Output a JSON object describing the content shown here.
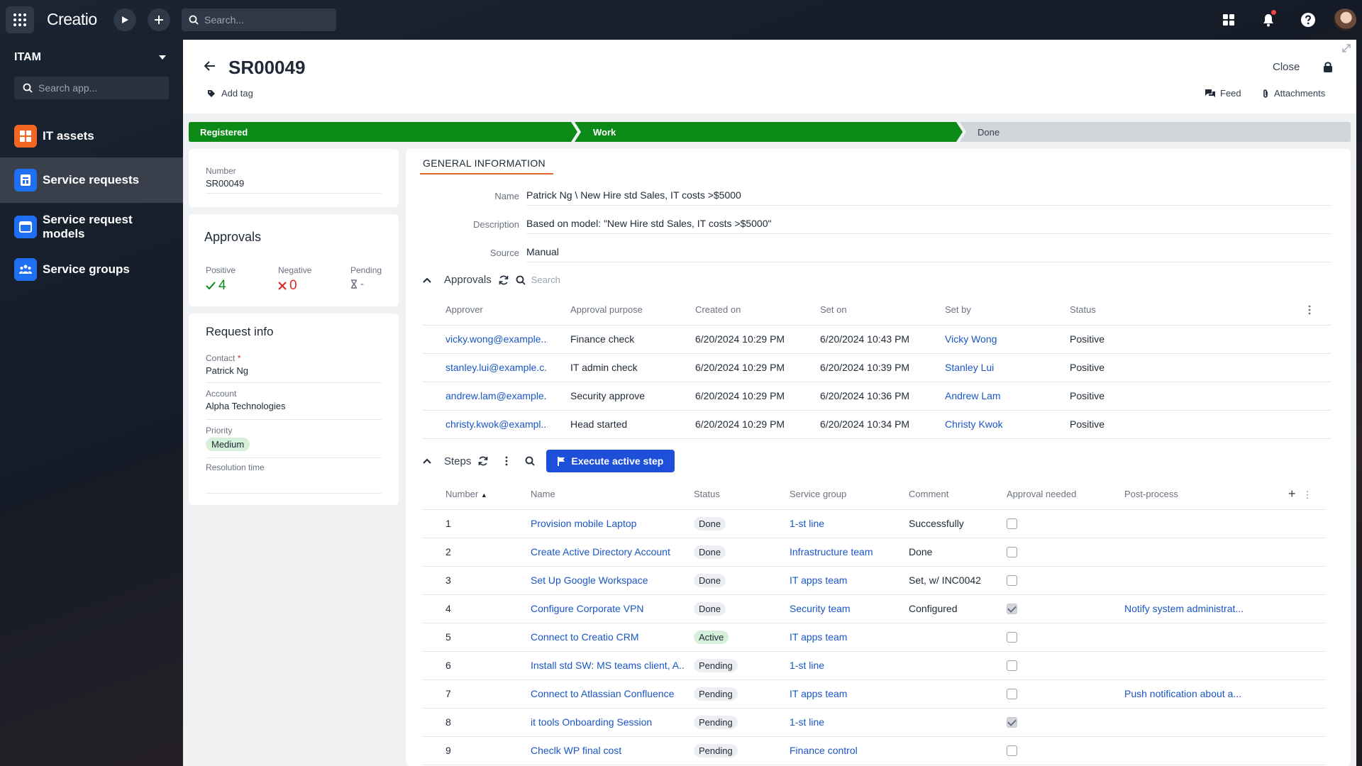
{
  "topbar": {
    "logo": "Creatio",
    "search_placeholder": "Search...",
    "icons": [
      "apps-grid-icon",
      "play-icon",
      "plus-icon",
      "search-icon",
      "app-switcher-icon",
      "bell-icon",
      "help-icon",
      "avatar"
    ]
  },
  "sidebar": {
    "title": "ITAM",
    "search_placeholder": "Search app...",
    "items": [
      {
        "label": "IT assets",
        "icon": "it-assets-icon",
        "color": "#f26522"
      },
      {
        "label": "Service requests",
        "icon": "service-requests-icon",
        "color": "#1e6ff2",
        "active": true
      },
      {
        "label": "Service request models",
        "icon": "service-request-models-icon",
        "color": "#1e6ff2"
      },
      {
        "label": "Service groups",
        "icon": "service-groups-icon",
        "color": "#1e6ff2"
      }
    ]
  },
  "header": {
    "title": "SR00049",
    "add_tag": "Add tag",
    "close": "Close",
    "feed": "Feed",
    "attachments": "Attachments"
  },
  "stages": [
    {
      "label": "Registered",
      "state": "complete"
    },
    {
      "label": "Work",
      "state": "complete"
    },
    {
      "label": "Done",
      "state": "pending"
    }
  ],
  "colors": {
    "stage_active": "#0b8a17",
    "stage_inactive": "#d1d4d8",
    "accent_tab": "#e5652e",
    "link": "#1a56c4",
    "primary_button": "#1e4fd8"
  },
  "number_card": {
    "label": "Number",
    "value": "SR00049"
  },
  "approvals_card": {
    "title": "Approvals",
    "positive": {
      "label": "Positive",
      "value": "4"
    },
    "negative": {
      "label": "Negative",
      "value": "0"
    },
    "pending": {
      "label": "Pending",
      "value": "-"
    }
  },
  "request_info": {
    "title": "Request info",
    "contact_label": "Contact",
    "contact": "Patrick Ng",
    "account_label": "Account",
    "account": "Alpha Technologies",
    "priority_label": "Priority",
    "priority": "Medium",
    "resolution_label": "Resolution time",
    "resolution": ""
  },
  "general_info": {
    "tab": "GENERAL INFORMATION",
    "name_label": "Name",
    "name": "Patrick Ng \\ New Hire std Sales, IT costs >$5000",
    "description_label": "Description",
    "description": "Based on model: \"New Hire std Sales, IT costs >$5000\"",
    "source_label": "Source",
    "source": "Manual"
  },
  "approvals_section": {
    "title": "Approvals",
    "search_placeholder": "Search",
    "columns": [
      "Approver",
      "Approval purpose",
      "Created on",
      "Set on",
      "Set by",
      "Status"
    ],
    "rows": [
      {
        "approver": "vicky.wong@example....",
        "purpose": "Finance check",
        "created": "6/20/2024 10:29 PM",
        "set_on": "6/20/2024 10:43 PM",
        "set_by": "Vicky Wong",
        "status": "Positive"
      },
      {
        "approver": "stanley.lui@example.c...",
        "purpose": "IT admin check",
        "created": "6/20/2024 10:29 PM",
        "set_on": "6/20/2024 10:39 PM",
        "set_by": "Stanley Lui",
        "status": "Positive"
      },
      {
        "approver": "andrew.lam@example....",
        "purpose": "Security approve",
        "created": "6/20/2024 10:29 PM",
        "set_on": "6/20/2024 10:36 PM",
        "set_by": "Andrew Lam",
        "status": "Positive"
      },
      {
        "approver": "christy.kwok@exampl...",
        "purpose": "Head started",
        "created": "6/20/2024 10:29 PM",
        "set_on": "6/20/2024 10:34 PM",
        "set_by": "Christy Kwok",
        "status": "Positive"
      }
    ]
  },
  "steps_section": {
    "title": "Steps",
    "execute_button": "Execute active step",
    "columns": [
      "Number",
      "Name",
      "Status",
      "Service group",
      "Comment",
      "Approval needed",
      "Post-process"
    ],
    "rows": [
      {
        "number": "1",
        "name": "Provision mobile Laptop",
        "status": "Done",
        "group": "1-st line",
        "comment": "Successfully",
        "approval": false,
        "post": ""
      },
      {
        "number": "2",
        "name": "Create Active Directory Account",
        "status": "Done",
        "group": "Infrastructure team",
        "comment": "Done",
        "approval": false,
        "post": ""
      },
      {
        "number": "3",
        "name": "Set Up Google Workspace",
        "status": "Done",
        "group": "IT apps team",
        "comment": "Set, w/ INC0042",
        "approval": false,
        "post": ""
      },
      {
        "number": "4",
        "name": "Configure Corporate VPN",
        "status": "Done",
        "group": "Security team",
        "comment": "Configured",
        "approval": true,
        "post": "Notify system administrat..."
      },
      {
        "number": "5",
        "name": "Connect to Creatio CRM",
        "status": "Active",
        "group": "IT apps team",
        "comment": "",
        "approval": false,
        "post": ""
      },
      {
        "number": "6",
        "name": "Install std SW: MS teams client, A...",
        "status": "Pending",
        "group": "1-st line",
        "comment": "",
        "approval": false,
        "post": ""
      },
      {
        "number": "7",
        "name": "Connect to Atlassian Confluence",
        "status": "Pending",
        "group": "IT apps team",
        "comment": "",
        "approval": false,
        "post": "Push notification about a..."
      },
      {
        "number": "8",
        "name": "it tools Onboarding Session",
        "status": "Pending",
        "group": "1-st line",
        "comment": "",
        "approval": true,
        "post": ""
      },
      {
        "number": "9",
        "name": "Checlk WP final cost",
        "status": "Pending",
        "group": "Finance control",
        "comment": "",
        "approval": false,
        "post": ""
      }
    ]
  }
}
